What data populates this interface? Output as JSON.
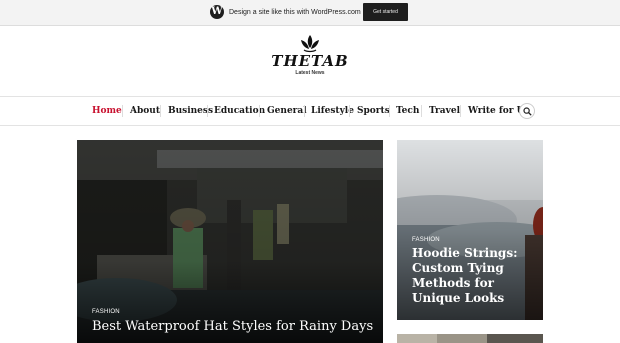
{
  "wpbar": {
    "logo_glyph": "W",
    "text": "Design a site like this with WordPress.com",
    "button_label": "Get started"
  },
  "site": {
    "title": "THETAB",
    "tagline": "Latest News"
  },
  "nav": {
    "items": [
      {
        "label": "Home",
        "active": true
      },
      {
        "label": "About"
      },
      {
        "label": "Business"
      },
      {
        "label": "Education"
      },
      {
        "label": "General"
      },
      {
        "label": "Lifestyle"
      },
      {
        "label": "Sports"
      },
      {
        "label": "Tech"
      },
      {
        "label": "Travel"
      },
      {
        "label": "Write for Us"
      }
    ],
    "search_icon": "search-icon",
    "active_color": "#c8102e"
  },
  "posts": {
    "main": {
      "category": "FASHION",
      "title": "Best Waterproof Hat Styles for Rainy Days"
    },
    "side": {
      "category": "FASHION",
      "title": "Hoodie Strings: Custom Tying Methods for Unique Looks"
    }
  }
}
